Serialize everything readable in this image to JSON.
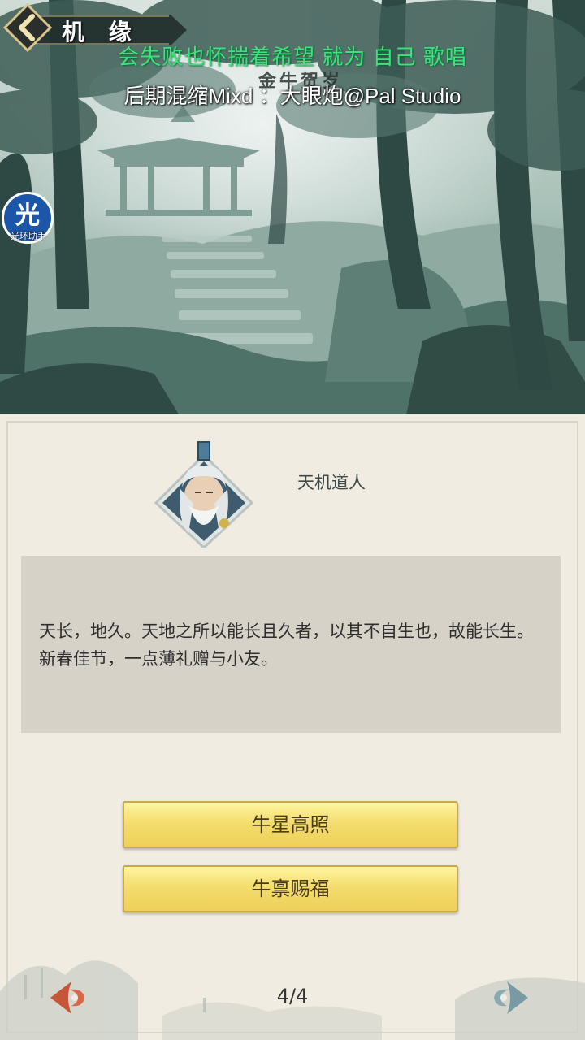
{
  "header": {
    "title": "机 缘",
    "back_icon": "chevron-left-icon"
  },
  "overlay": {
    "lyric_line1": "会失败也怀揣着希望  就为 自己 歌唱",
    "lyric_line2": "后期混缩Mixd ：大眼炮@Pal Studio"
  },
  "scene": {
    "title": "金牛贺岁"
  },
  "assistant": {
    "glyph": "光",
    "label": "光环助手"
  },
  "dialog": {
    "speaker": "天机道人",
    "text": "天长，地久。天地之所以能长且久者，以其不自生也，故能长生。新春佳节，一点薄礼赠与小友。"
  },
  "choices": [
    {
      "label": "牛星高照"
    },
    {
      "label": "牛禀赐福"
    }
  ],
  "pagination": {
    "indicator": "4/4",
    "prev_icon": "arrow-left-icon",
    "next_icon": "arrow-right-icon"
  },
  "colors": {
    "lyric_green": "#3ee27a",
    "button_gold": "#f3dd6e",
    "prev_arrow": "#c8553a",
    "next_arrow": "#7a9aa3"
  }
}
